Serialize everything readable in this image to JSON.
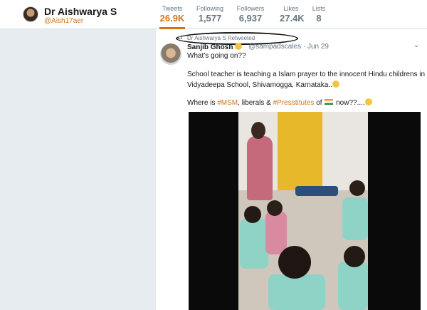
{
  "profile": {
    "name": "Dr Aishwarya S",
    "handle": "@Aish17aer"
  },
  "stats": [
    {
      "label": "Tweets",
      "value": "26.9K"
    },
    {
      "label": "Following",
      "value": "1,577"
    },
    {
      "label": "Followers",
      "value": "6,937"
    },
    {
      "label": "Likes",
      "value": "27.4K"
    },
    {
      "label": "Lists",
      "value": "8"
    }
  ],
  "retweet": {
    "text": "Dr Aishwarya S Retweeted"
  },
  "tweet": {
    "author": "Sanjib Ghosh",
    "meta": "@sampadscales · Jun 29",
    "line1": "What's going on??",
    "line2": "School teacher is teaching a Islam prayer to the innocent Hindu childrens in",
    "line3": "Vidyadeepa School, Shivamogga, Karnataka..",
    "line4_prefix": "Where is ",
    "tag1": "#MSM",
    "line4_mid": ", liberals & ",
    "tag2": "#Presstitutes",
    "line4_of": " of ",
    "line4_end": " now??....",
    "caret": "⌄"
  },
  "colors": {
    "accent": "#d1741c",
    "background": "#e6ecf0"
  },
  "icons": {
    "retweet": "retweet-icon",
    "caret": "chevron-down-icon"
  }
}
